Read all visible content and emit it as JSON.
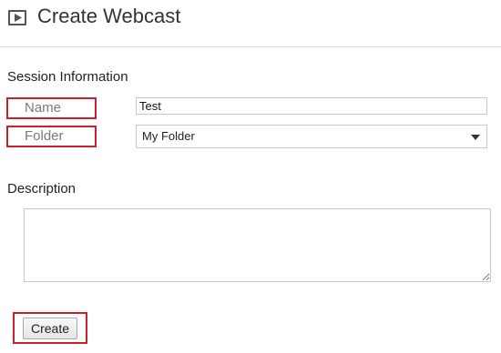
{
  "header": {
    "icon": "play-window-icon",
    "title": "Create Webcast"
  },
  "session_information": {
    "heading": "Session Information",
    "name_label": "Name",
    "name_value": "Test",
    "folder_label": "Folder",
    "folder_selected": "My Folder"
  },
  "description": {
    "heading": "Description",
    "value": ""
  },
  "actions": {
    "create_label": "Create"
  },
  "colors": {
    "highlight": "#c8202c",
    "border": "#c9c9c9"
  }
}
